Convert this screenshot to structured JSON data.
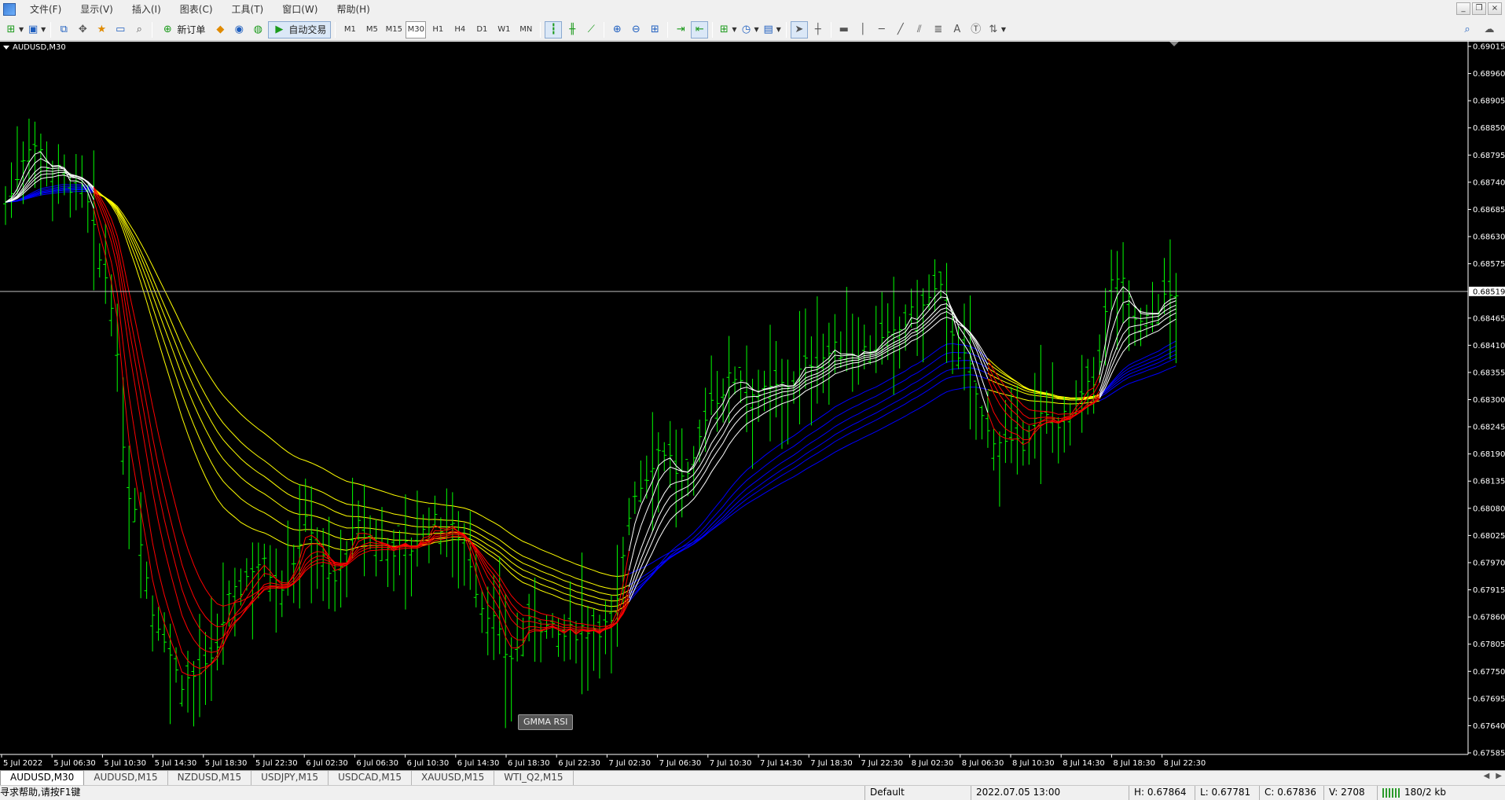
{
  "menu": {
    "items": [
      "文件(F)",
      "显示(V)",
      "插入(I)",
      "图表(C)",
      "工具(T)",
      "窗口(W)",
      "帮助(H)"
    ]
  },
  "toolbar": {
    "new_order_label": "新订单",
    "auto_trading_label": "自动交易",
    "timeframes": [
      "M1",
      "M5",
      "M15",
      "M30",
      "H1",
      "H4",
      "D1",
      "W1",
      "MN"
    ],
    "active_timeframe": "M30"
  },
  "chart": {
    "symbol_label": "AUDUSD,M30",
    "indicator_button": "GMMA RSI",
    "current_price_label": "0.68519",
    "colors": {
      "background": "#000000",
      "candle": "#00ff00",
      "ema_fast_up": "#ffffff",
      "ema_fast_down": "#ff0000",
      "ema_slow_up": "#0000ff",
      "ema_slow_down": "#ffff00",
      "price_line": "#c0c0c0"
    }
  },
  "chart_data": {
    "type": "line",
    "ylim": [
      0.67585,
      0.69015
    ],
    "y_ticks": [
      "0.69015",
      "0.68960",
      "0.68905",
      "0.68850",
      "0.68795",
      "0.68740",
      "0.68685",
      "0.68630",
      "0.68575",
      "0.68519",
      "0.68465",
      "0.68410",
      "0.68355",
      "0.68300",
      "0.68245",
      "0.68190",
      "0.68135",
      "0.68080",
      "0.68025",
      "0.67970",
      "0.67915",
      "0.67860",
      "0.67805",
      "0.67750",
      "0.67695",
      "0.67640",
      "0.67585"
    ],
    "x_ticks": [
      "5 Jul 2022",
      "5 Jul 06:30",
      "5 Jul 10:30",
      "5 Jul 14:30",
      "5 Jul 18:30",
      "5 Jul 22:30",
      "6 Jul 02:30",
      "6 Jul 06:30",
      "6 Jul 10:30",
      "6 Jul 14:30",
      "6 Jul 18:30",
      "6 Jul 22:30",
      "7 Jul 02:30",
      "7 Jul 06:30",
      "7 Jul 10:30",
      "7 Jul 14:30",
      "7 Jul 18:30",
      "7 Jul 22:30",
      "8 Jul 02:30",
      "8 Jul 06:30",
      "8 Jul 10:30",
      "8 Jul 14:30",
      "8 Jul 18:30",
      "8 Jul 22:30"
    ],
    "current_price": 0.68519,
    "price_path": [
      [
        0,
        0.687
      ],
      [
        0.5,
        0.6882
      ],
      [
        1,
        0.6876
      ],
      [
        1.5,
        0.6872
      ],
      [
        2,
        0.6855
      ],
      [
        2.5,
        0.681
      ],
      [
        3,
        0.6785
      ],
      [
        3.5,
        0.6773
      ],
      [
        4,
        0.6775
      ],
      [
        4.5,
        0.679
      ],
      [
        5,
        0.6797
      ],
      [
        5.5,
        0.6793
      ],
      [
        6,
        0.6805
      ],
      [
        6.5,
        0.6793
      ],
      [
        7,
        0.6804
      ],
      [
        7.5,
        0.68
      ],
      [
        8,
        0.68
      ],
      [
        8.5,
        0.6805
      ],
      [
        9,
        0.6803
      ],
      [
        9.5,
        0.6788
      ],
      [
        10,
        0.6778
      ],
      [
        10.5,
        0.6785
      ],
      [
        11,
        0.6782
      ],
      [
        11.5,
        0.6784
      ],
      [
        12,
        0.6784
      ],
      [
        12.5,
        0.6812
      ],
      [
        13,
        0.682
      ],
      [
        13.5,
        0.6813
      ],
      [
        14,
        0.683
      ],
      [
        14.5,
        0.6835
      ],
      [
        15,
        0.6831
      ],
      [
        15.5,
        0.6833
      ],
      [
        16,
        0.6838
      ],
      [
        16.5,
        0.684
      ],
      [
        17,
        0.684
      ],
      [
        17.5,
        0.6842
      ],
      [
        18,
        0.6847
      ],
      [
        18.5,
        0.6852
      ],
      [
        19,
        0.6838
      ],
      [
        19.5,
        0.6823
      ],
      [
        20,
        0.682
      ],
      [
        20.5,
        0.6826
      ],
      [
        21,
        0.6826
      ],
      [
        21.5,
        0.6832
      ],
      [
        22,
        0.6855
      ],
      [
        22.5,
        0.6845
      ],
      [
        23,
        0.685
      ],
      [
        23.2,
        0.6852
      ]
    ]
  },
  "tabs": {
    "items": [
      "AUDUSD,M30",
      "AUDUSD,M15",
      "NZDUSD,M15",
      "USDJPY,M15",
      "USDCAD,M15",
      "XAUUSD,M15",
      "WTI_Q2,M15"
    ],
    "active": 0
  },
  "status": {
    "help": "寻求帮助,请按F1键",
    "profile": "Default",
    "datetime": "2022.07.05 13:00",
    "high": "H: 0.67864",
    "low": "L: 0.67781",
    "close": "C: 0.67836",
    "volume": "V: 2708",
    "traffic": "180/2 kb"
  }
}
